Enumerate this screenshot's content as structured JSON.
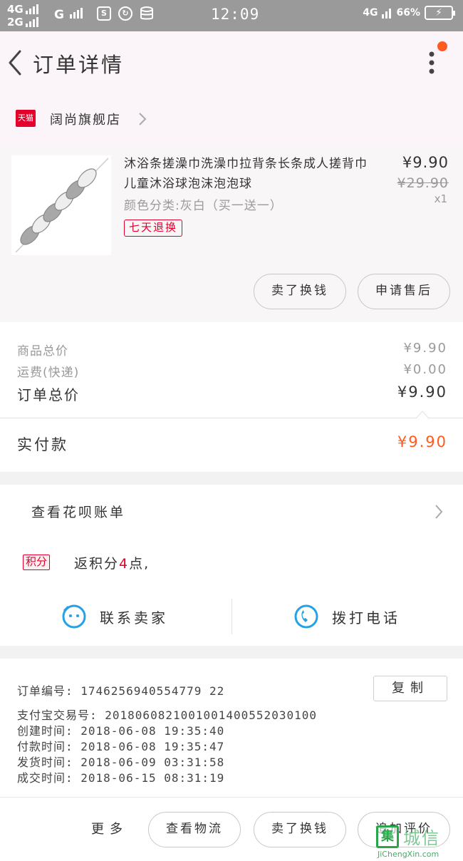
{
  "status_bar": {
    "net_top": "4G",
    "net_bottom": "2G",
    "net_mid": "G",
    "icon_sim": "S",
    "time": "12:09",
    "net_right": "4G",
    "battery_text": "66%"
  },
  "nav": {
    "title": "订单详情"
  },
  "store": {
    "badge": "天猫",
    "name": "阔尚旗舰店"
  },
  "item": {
    "title": "沐浴条搓澡巾洗澡巾拉背条长条成人搓背巾儿童沐浴球泡沫泡泡球",
    "sku": "颜色分类:灰白（买一送一）",
    "return_tag": "七天退换",
    "price_now": "¥9.90",
    "price_old": "¥29.90",
    "qty": "x1",
    "btn_buy_swap": "卖了换钱",
    "btn_after_sale": "申请售后"
  },
  "summary": {
    "goods_total_label": "商品总价",
    "goods_total_value": "¥9.90",
    "shipping_label": "运费(快递)",
    "shipping_value": "¥0.00",
    "order_total_label": "订单总价",
    "order_total_value": "¥9.90",
    "paid_label": "实付款",
    "paid_value": "¥9.90"
  },
  "credit": {
    "huabei_label": "查看花呗账单",
    "points_badge": "积分",
    "points_prefix": "返积分",
    "points_num": "4",
    "points_suffix": "点,"
  },
  "contact": {
    "seller": "联系卖家",
    "phone": "拨打电话"
  },
  "order_info": {
    "order_no": "订单编号:  1746256940554779 22",
    "copy": "复制",
    "alipay_no": "支付宝交易号:  2018060821001001400552030100",
    "created": "创建时间:  2018-06-08 19:35:40",
    "paid": "付款时间:  2018-06-08 19:35:47",
    "shipped": "发货时间:  2018-06-09 03:31:58",
    "completed": "成交时间:  2018-06-15 08:31:19"
  },
  "bottom": {
    "more": "更多",
    "logistics": "查看物流",
    "buy_swap": "卖了换钱",
    "review": "追加评价"
  },
  "watermark": {
    "mark": "集",
    "text": "城信",
    "sub": "JiChengXin.com"
  },
  "colors": {
    "accent_orange": "#ff5a1f",
    "tmall_red": "#e4002b",
    "contact_blue": "#27a1e5"
  }
}
